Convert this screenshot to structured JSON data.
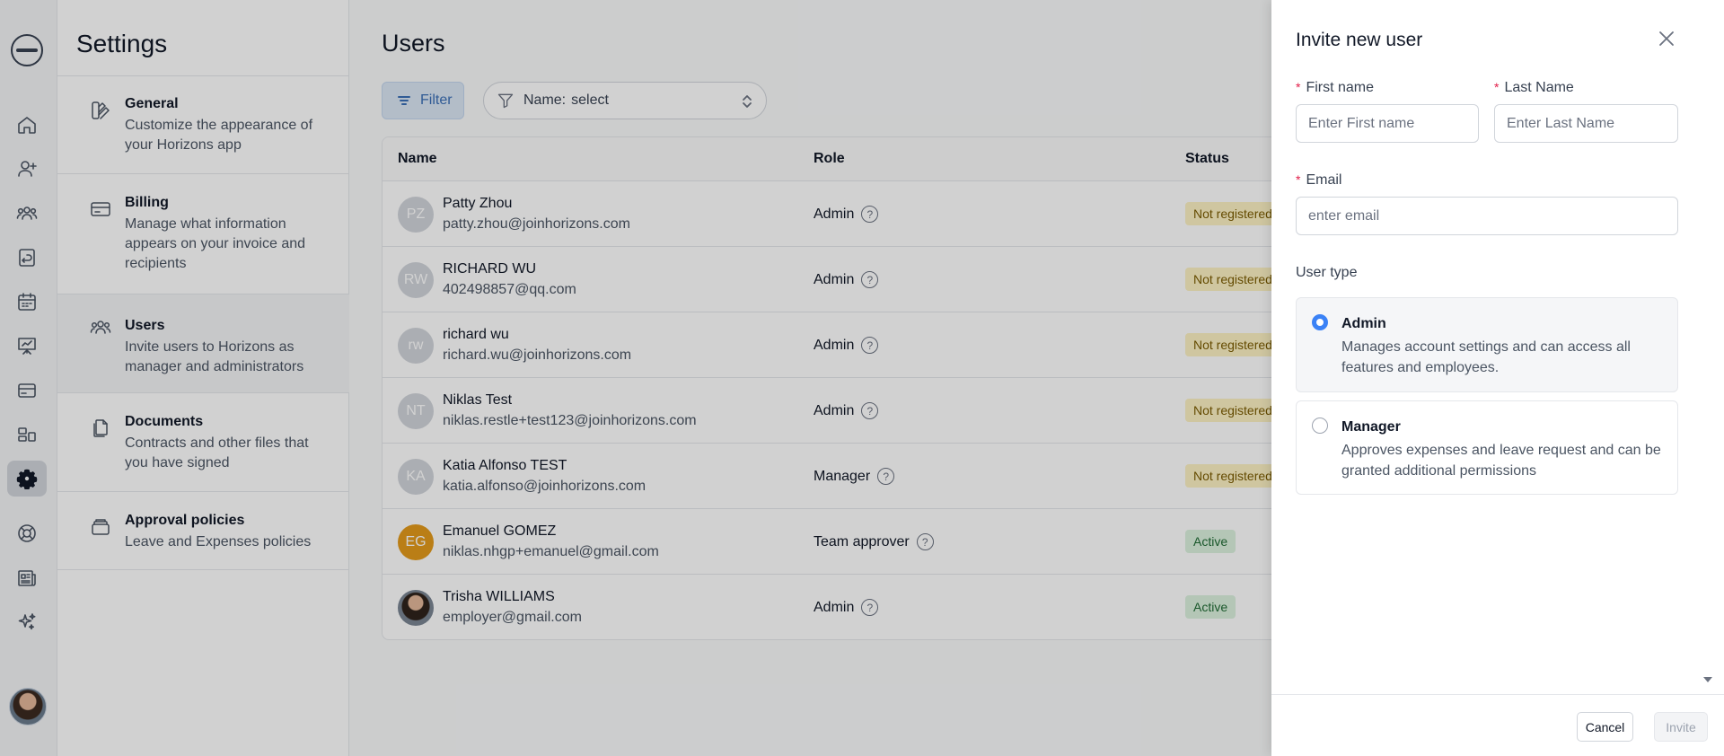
{
  "rail": {
    "icons": [
      "logo",
      "home-icon",
      "add-user-icon",
      "team-icon",
      "leave-icon",
      "calendar-icon",
      "presentation-icon",
      "card-icon",
      "apps-icon",
      "settings-icon",
      "help-icon",
      "news-icon",
      "sparkle-icon"
    ]
  },
  "settings": {
    "title": "Settings",
    "items": [
      {
        "title": "General",
        "desc": "Customize the appearance of your Horizons app"
      },
      {
        "title": "Billing",
        "desc": "Manage what information appears on your invoice and recipients"
      },
      {
        "title": "Users",
        "desc": "Invite users to Horizons as manager and administrators"
      },
      {
        "title": "Documents",
        "desc": "Contracts and other files that you have signed"
      },
      {
        "title": "Approval policies",
        "desc": "Leave and Expenses policies"
      }
    ]
  },
  "users": {
    "title": "Users",
    "filter_label": "Filter",
    "name_filter": {
      "label": "Name:",
      "value": "select"
    },
    "columns": {
      "name": "Name",
      "role": "Role",
      "status": "Status"
    },
    "rows": [
      {
        "initials": "PZ",
        "name": "Patty Zhou",
        "email": "patty.zhou@joinhorizons.com",
        "role": "Admin",
        "status": "Not registered"
      },
      {
        "initials": "RW",
        "name": "RICHARD WU",
        "email": "402498857@qq.com",
        "role": "Admin",
        "status": "Not registered"
      },
      {
        "initials": "rw",
        "name": "richard wu",
        "email": "richard.wu@joinhorizons.com",
        "role": "Admin",
        "status": "Not registered"
      },
      {
        "initials": "NT",
        "name": "Niklas Test",
        "email": "niklas.restle+test123@joinhorizons.com",
        "role": "Admin",
        "status": "Not registered"
      },
      {
        "initials": "KA",
        "name": "Katia Alfonso TEST",
        "email": "katia.alfonso@joinhorizons.com",
        "role": "Manager",
        "status": "Not registered"
      },
      {
        "initials": "EG",
        "name": "Emanuel GOMEZ",
        "email": "niklas.nhgp+emanuel@gmail.com",
        "role": "Team approver",
        "status": "Active"
      },
      {
        "initials": "",
        "name": "Trisha WILLIAMS",
        "email": "employer@gmail.com",
        "role": "Admin",
        "status": "Active"
      }
    ],
    "help_glyph": "?"
  },
  "drawer": {
    "title": "Invite new user",
    "required_mark": "*",
    "first_name": {
      "label": "First name",
      "placeholder": "Enter First name",
      "value": ""
    },
    "last_name": {
      "label": "Last Name",
      "placeholder": "Enter Last Name",
      "value": ""
    },
    "email": {
      "label": "Email",
      "placeholder": "enter email",
      "value": ""
    },
    "user_type_label": "User type",
    "options": [
      {
        "title": "Admin",
        "desc": "Manages account settings and can access all features and employees.",
        "selected": true
      },
      {
        "title": "Manager",
        "desc": "Approves expenses and leave request and can be granted additional permissions",
        "selected": false
      }
    ],
    "cancel_label": "Cancel",
    "invite_label": "Invite"
  },
  "colors": {
    "accent": "#3b82f6",
    "warn_badge": "#fdf2c4",
    "ok_badge": "#dcf2df",
    "eg_avatar": "#e39a1b"
  }
}
